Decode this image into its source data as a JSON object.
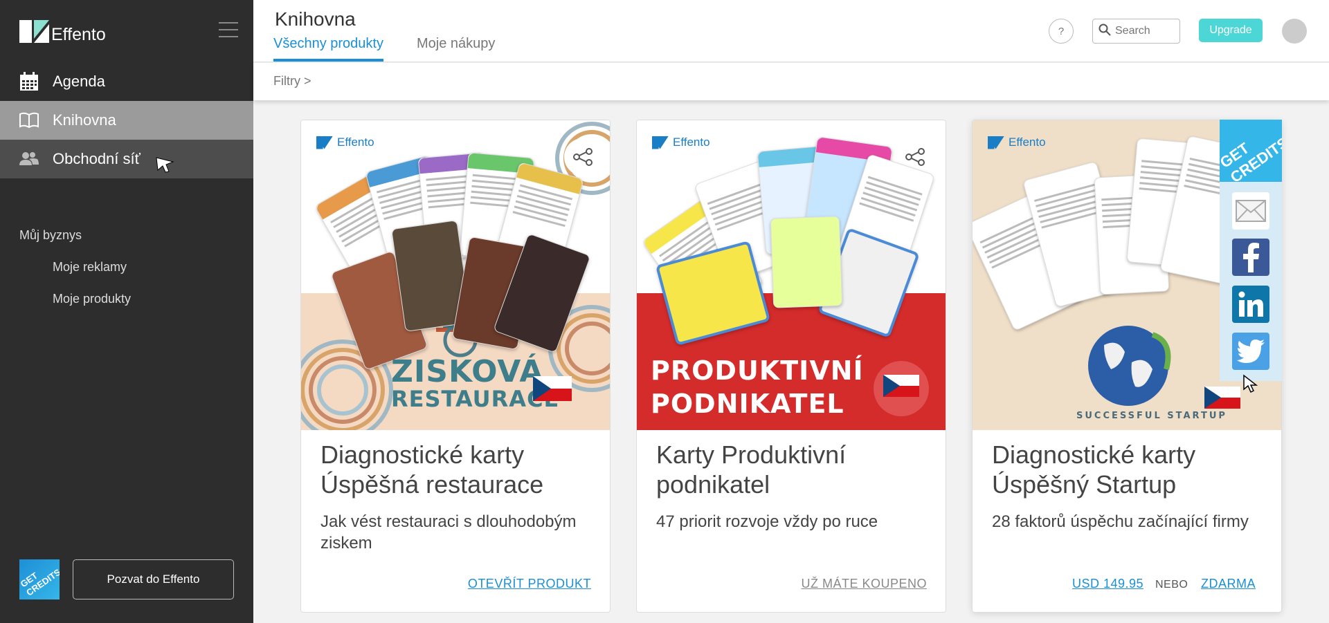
{
  "sidebar": {
    "brand": "Effento",
    "nav": [
      {
        "label": "Agenda",
        "icon": "calendar-icon"
      },
      {
        "label": "Knihovna",
        "icon": "book-icon"
      },
      {
        "label": "Obchodní síť",
        "icon": "people-icon"
      }
    ],
    "business_title": "Můj byznys",
    "business_links": [
      "Moje reklamy",
      "Moje produkty"
    ],
    "credits_badge": "GET CREDITS",
    "invite_label": "Pozvat do Effento"
  },
  "header": {
    "title": "Knihovna",
    "tabs": [
      "Všechny produkty",
      "Moje nákupy"
    ],
    "help_label": "?",
    "search_placeholder": "Search",
    "upgrade_label": "Upgrade"
  },
  "filter_label": "Filtry >",
  "colors": {
    "accent": "#1a8fd6",
    "upgrade": "#4dd6d6",
    "sidebar_bg": "#2d2d2d",
    "card2_banner": "#d42b2b",
    "card1_banner": "#f4d9c3"
  },
  "products": [
    {
      "brand": "Effento",
      "image_title_line1": "ZISKOVÁ",
      "image_title_line2": "RESTAURACE",
      "title": "Diagnostické karty Úspěšná restaurace",
      "subtitle": "Jak vést restauraci s dlouhodobým ziskem",
      "action": "OTEVŘÍT PRODUKT"
    },
    {
      "brand": "Effento",
      "image_title_line1": "PRODUKTIVNÍ",
      "image_title_line2": "PODNIKATEL",
      "title": "Karty Produktivní podnikatel",
      "subtitle": "47 priorit rozvoje vždy po ruce",
      "action": "UŽ MÁTE KOUPENO"
    },
    {
      "brand": "Effento",
      "image_title_line1": "SUCCESSFUL STARTUP",
      "title": "Diagnostické karty Úspěšný Startup",
      "subtitle": "28 faktorů úspěchu začínající firmy",
      "price": "USD 149.95",
      "or_label": "NEBO",
      "free_label": "ZDARMA"
    }
  ],
  "share_panel": {
    "credits": "GET CREDITS",
    "items": [
      "email-icon",
      "facebook-icon",
      "linkedin-icon",
      "twitter-icon"
    ]
  }
}
